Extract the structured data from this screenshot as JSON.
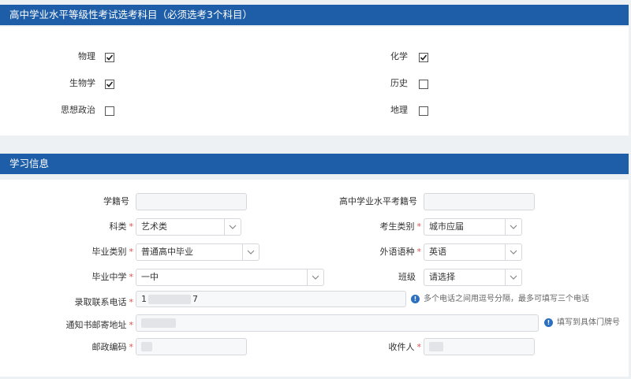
{
  "subjects_section": {
    "title": "高中学业水平等级性考试选考科目（必须选考3个科目）",
    "items": [
      {
        "label": "物理",
        "checked": true
      },
      {
        "label": "化学",
        "checked": true
      },
      {
        "label": "生物学",
        "checked": true
      },
      {
        "label": "历史",
        "checked": false
      },
      {
        "label": "思想政治",
        "checked": false
      },
      {
        "label": "地理",
        "checked": false
      }
    ]
  },
  "study_section": {
    "title": "学习信息",
    "fields": {
      "student_id": {
        "label": "学籍号",
        "value": ""
      },
      "exam_id": {
        "label": "高中学业水平考籍号",
        "value": ""
      },
      "category": {
        "label": "科类",
        "value": "艺术类"
      },
      "examinee_type": {
        "label": "考生类别",
        "value": "城市应届"
      },
      "graduation_type": {
        "label": "毕业类别",
        "value": "普通高中毕业"
      },
      "foreign_language": {
        "label": "外语语种",
        "value": "英语"
      },
      "high_school": {
        "label": "毕业中学",
        "value": "一中"
      },
      "class": {
        "label": "班级",
        "value": "请选择"
      },
      "phone": {
        "label": "录取联系电话",
        "value_start": "1",
        "value_end": "7",
        "hint": "多个电话之间用逗号分隔，最多可填写三个电话"
      },
      "address": {
        "label": "通知书邮寄地址",
        "value": "",
        "hint": "填写到具体门牌号"
      },
      "postal_code": {
        "label": "邮政编码",
        "value": ""
      },
      "recipient": {
        "label": "收件人",
        "value": ""
      }
    },
    "required_mark": "*"
  },
  "icons": {
    "checkbox_check": "check-icon",
    "dropdown": "chevron-down-icon",
    "info": "info-icon"
  },
  "colors": {
    "header_bg": "#1e5ea8",
    "required": "#d9534f",
    "info": "#2b6fc1"
  }
}
